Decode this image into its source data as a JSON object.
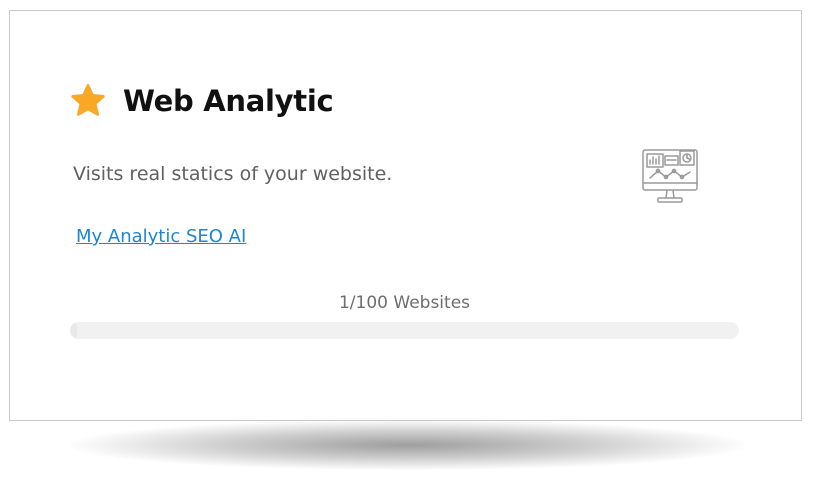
{
  "card": {
    "title": "Web Analytic",
    "title_icon": "star-icon",
    "description": "Visits real statics of your website.",
    "link_label": "My Analytic SEO AI",
    "illustration_icon": "analytics-monitor-icon",
    "usage": {
      "label": "1/100 Websites",
      "used": 1,
      "total": 100,
      "fraction": 0.01
    }
  },
  "colors": {
    "star": "#f9a825",
    "link": "#1a86d6",
    "icon_stroke": "#9a9a9a",
    "progress_track": "#f1f1f1"
  }
}
